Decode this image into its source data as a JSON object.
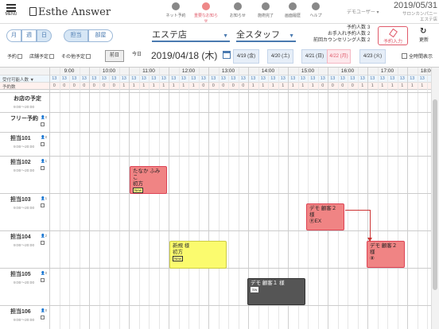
{
  "header": {
    "menu_label": "MENU",
    "app_title": "Esthe Answer",
    "nav": [
      {
        "label": "ネット予約",
        "icon": "globe-icon"
      },
      {
        "label": "重要なお知らせ",
        "icon": "bell-icon"
      },
      {
        "label": "お知らせ",
        "icon": "info-icon"
      },
      {
        "label": "施術完了",
        "icon": "check-icon"
      },
      {
        "label": "画面履歴",
        "icon": "history-icon"
      },
      {
        "label": "ヘルプ",
        "icon": "help-icon"
      }
    ],
    "user_name": "デモユーザー ▾",
    "date": "2019/05/31",
    "company": "サロンカンパニー",
    "store_short": "エステ店"
  },
  "toolbar": {
    "view_month": "月",
    "view_week": "週",
    "view_day": "日",
    "view_staff": "担当",
    "view_dept": "部屋",
    "store_select": "エステ店",
    "staff_select": "全スタッフ",
    "counts": [
      {
        "label": "予約人数",
        "value": "3"
      },
      {
        "label": "お手入れ予約人数",
        "value": "2"
      },
      {
        "label": "前回カウンセリング人数",
        "value": "2"
      }
    ],
    "reserve_button": "予約入力",
    "refresh_button": "更新",
    "legend_reserved": "予約",
    "legend_unplanned": "店舗予定",
    "legend_other": "その他予定",
    "prev_button": "前日",
    "today_button": "今日",
    "current_date": "2019/04/18 (木)",
    "date_tabs": [
      "4/19 (金)",
      "4/20 (土)",
      "4/21 (日)",
      "4/22 (月)",
      "4/23 (火)"
    ],
    "show_all_label": "全時間表示"
  },
  "grid": {
    "row_label_available": "受付可能人数 ▼",
    "row_label_reserved": "予約数",
    "times": [
      "9:00",
      "10:00",
      "11:00",
      "12:00",
      "13:00",
      "14:00",
      "15:00",
      "16:00",
      "17:00",
      "18:00"
    ],
    "available_values": [
      "13",
      "13",
      "13",
      "13",
      "13",
      "13",
      "13",
      "13",
      "13",
      "13",
      "13",
      "13",
      "13",
      "13",
      "13",
      "13",
      "13",
      "13",
      "13",
      "13",
      "13",
      "13",
      "13",
      "13",
      "13",
      "13",
      "13",
      "13",
      "13",
      "13",
      "13",
      "13",
      "13",
      "13",
      "13",
      "13",
      "13",
      "13",
      "13",
      "13"
    ],
    "reserved_values": [
      "0",
      "0",
      "0",
      "0",
      "0",
      "0",
      "0",
      "1",
      "1",
      "1",
      "1",
      "1",
      "1",
      "1",
      "1",
      "0",
      "0",
      "0",
      "0",
      "0",
      "1",
      "1",
      "1",
      "1",
      "1",
      "1",
      "1",
      "0",
      "0",
      "0",
      "0",
      "1",
      "1",
      "1",
      "1",
      "1",
      "1",
      "1",
      "0",
      "0"
    ],
    "rows": [
      {
        "name": "お店の予定",
        "hours": "9:00〜20:00",
        "count": "",
        "is_store": true
      },
      {
        "name": "フリー予約",
        "hours": "",
        "count": "0"
      },
      {
        "name": "担当101",
        "hours": "9:00〜20:00",
        "count": "0"
      },
      {
        "name": "担当102",
        "hours": "9:00〜20:00",
        "count": "1"
      },
      {
        "name": "担当103",
        "hours": "9:00〜20:00",
        "count": "1"
      },
      {
        "name": "担当104",
        "hours": "9:00〜20:00",
        "count": "2"
      },
      {
        "name": "担当105",
        "hours": "9:00〜20:00",
        "count": "0"
      },
      {
        "name": "担当106",
        "hours": "9:00〜20:00",
        "count": "0"
      }
    ]
  },
  "appointments": [
    {
      "name": "たなか ふみこ",
      "sub": "初方",
      "tag": "New",
      "color": "#f08484"
    },
    {
      "name": "新規 様",
      "sub": "初方",
      "tag": "New",
      "color": "#fbfb6e"
    },
    {
      "name": "デモ 顧客２ 様",
      "sub": "ⓇEX",
      "tag": "",
      "color": "#f08484"
    },
    {
      "name": "デモ 顧客２ 様",
      "sub": "⑧",
      "tag": "",
      "color": "#f08484"
    },
    {
      "name": "デモ 顧客１ 様",
      "sub": "Sw",
      "tag": "",
      "color": "#555555"
    }
  ]
}
